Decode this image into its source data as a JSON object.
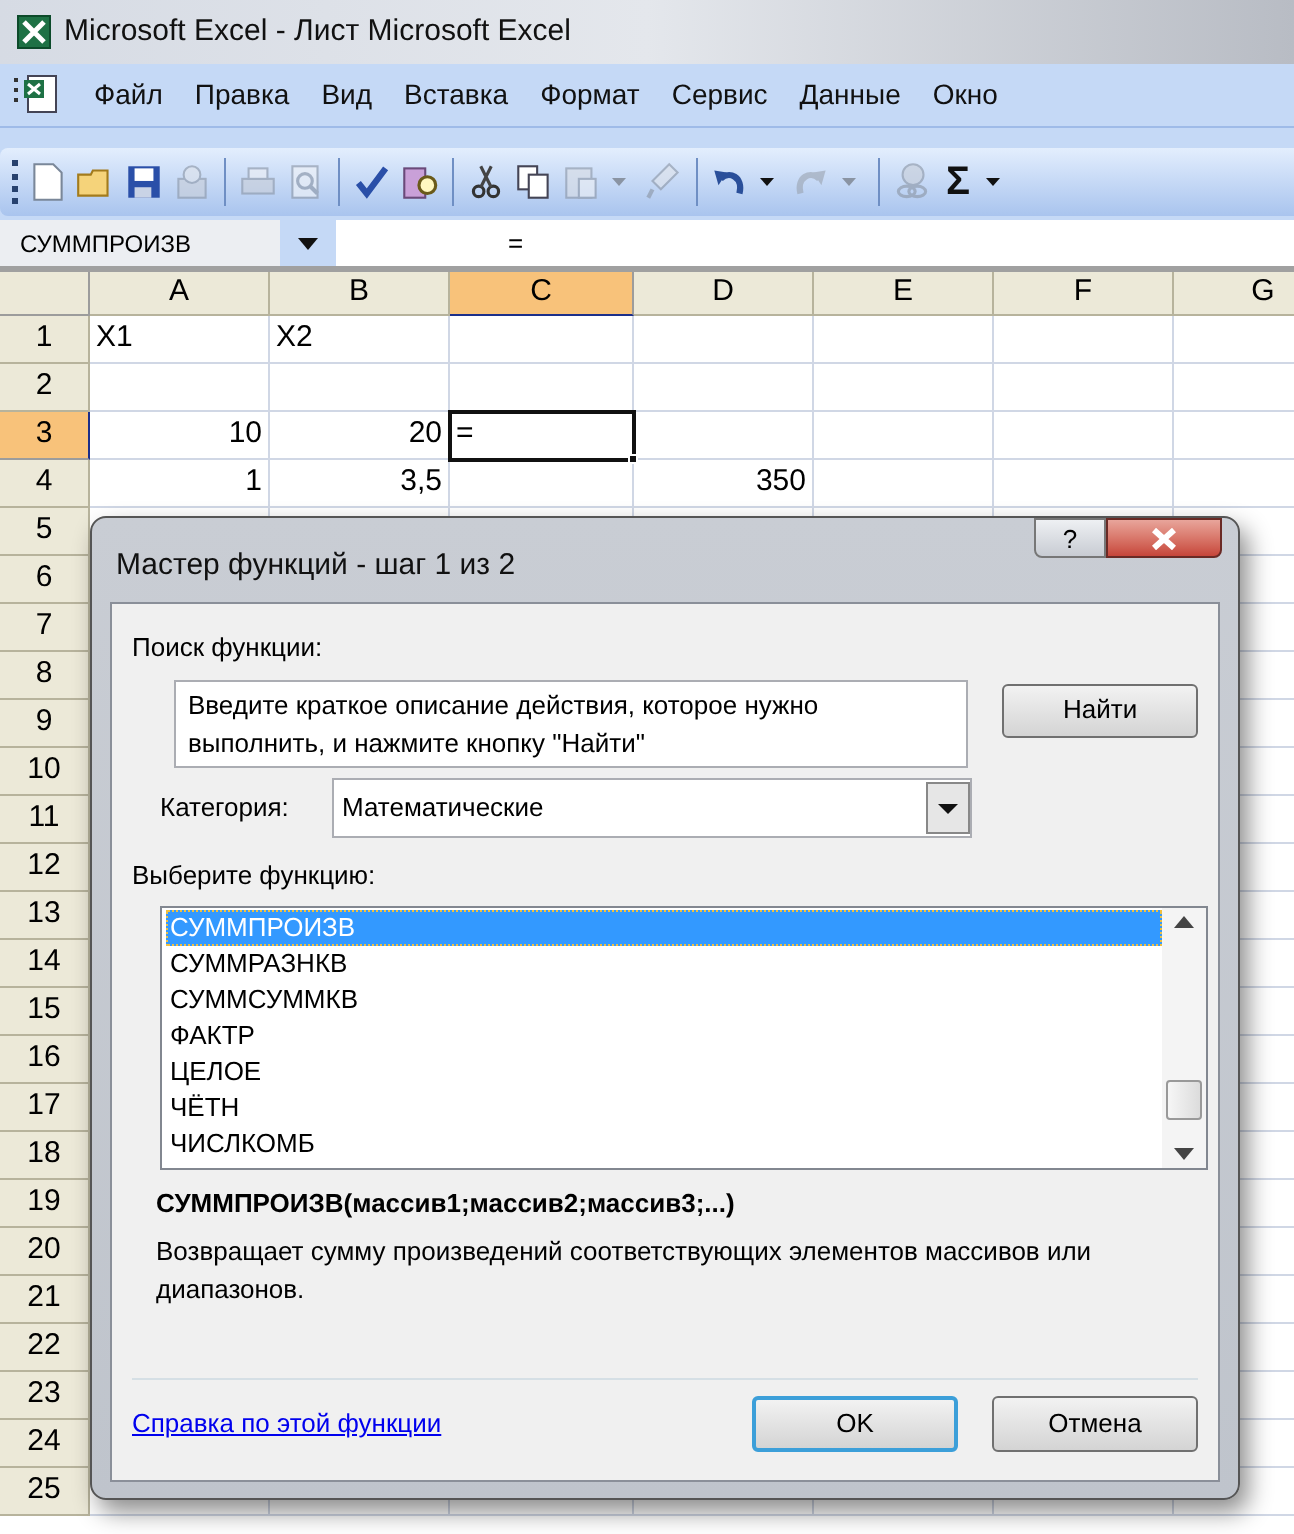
{
  "window": {
    "title": "Microsoft Excel - Лист Microsoft Excel"
  },
  "menu": [
    "Файл",
    "Правка",
    "Вид",
    "Вставка",
    "Формат",
    "Сервис",
    "Данные",
    "Окно"
  ],
  "toolbar": [
    [
      {
        "kind": "new",
        "disabled": false
      },
      {
        "kind": "open",
        "disabled": false
      },
      {
        "kind": "save",
        "disabled": false
      },
      {
        "kind": "permission",
        "disabled": true
      }
    ],
    [
      {
        "kind": "print",
        "disabled": true
      },
      {
        "kind": "preview",
        "disabled": true
      }
    ],
    [
      {
        "kind": "spelling",
        "disabled": false
      },
      {
        "kind": "research",
        "disabled": false
      }
    ],
    [
      {
        "kind": "cut",
        "disabled": false
      },
      {
        "kind": "copy",
        "disabled": false
      },
      {
        "kind": "paste",
        "disabled": true,
        "dropdown": true
      },
      {
        "kind": "painter",
        "disabled": true
      }
    ],
    [
      {
        "kind": "undo",
        "disabled": false,
        "dropdown": true
      },
      {
        "kind": "redo",
        "disabled": true,
        "dropdown": true
      }
    ],
    [
      {
        "kind": "hyperlink",
        "disabled": true
      },
      {
        "kind": "sum",
        "disabled": false,
        "dropdown": true,
        "glyph": "Σ"
      }
    ]
  ],
  "name_box": "СУММПРОИЗВ",
  "formula": "=",
  "columns": [
    {
      "label": "A",
      "selected": false
    },
    {
      "label": "B",
      "selected": false
    },
    {
      "label": "C",
      "selected": true
    },
    {
      "label": "D",
      "selected": false
    },
    {
      "label": "E",
      "selected": false
    },
    {
      "label": "F",
      "selected": false
    },
    {
      "label": "G",
      "selected": false
    }
  ],
  "rows": [
    {
      "label": "1",
      "selected": false,
      "cells": [
        {
          "text": "X1",
          "kind": "text",
          "selected": false
        },
        {
          "text": "X2",
          "kind": "text",
          "selected": false
        },
        {
          "selected": false
        },
        {
          "selected": false
        },
        {
          "selected": false
        },
        {
          "selected": false
        },
        {
          "selected": false
        }
      ]
    },
    {
      "label": "2",
      "selected": false,
      "cells": [
        {
          "selected": false
        },
        {
          "selected": false
        },
        {
          "selected": false
        },
        {
          "selected": false
        },
        {
          "selected": false
        },
        {
          "selected": false
        },
        {
          "selected": false
        }
      ]
    },
    {
      "label": "3",
      "selected": true,
      "cells": [
        {
          "text": "10",
          "kind": "number",
          "selected": false
        },
        {
          "text": "20",
          "kind": "number",
          "selected": false
        },
        {
          "text": "=",
          "kind": "text",
          "selected": true
        },
        {
          "selected": false
        },
        {
          "selected": false
        },
        {
          "selected": false
        },
        {
          "selected": false
        }
      ]
    },
    {
      "label": "4",
      "selected": false,
      "cells": [
        {
          "text": "1",
          "kind": "number",
          "selected": false
        },
        {
          "text": "3,5",
          "kind": "number",
          "selected": false
        },
        {
          "selected": false
        },
        {
          "text": "350",
          "kind": "number",
          "selected": false
        },
        {
          "selected": false
        },
        {
          "selected": false
        },
        {
          "selected": false
        }
      ]
    },
    {
      "label": "5",
      "selected": false
    },
    {
      "label": "6",
      "selected": false
    },
    {
      "label": "7",
      "selected": false
    },
    {
      "label": "8",
      "selected": false
    },
    {
      "label": "9",
      "selected": false
    },
    {
      "label": "10",
      "selected": false
    },
    {
      "label": "11",
      "selected": false
    },
    {
      "label": "12",
      "selected": false
    },
    {
      "label": "13",
      "selected": false
    },
    {
      "label": "14",
      "selected": false
    },
    {
      "label": "15",
      "selected": false
    },
    {
      "label": "16",
      "selected": false
    },
    {
      "label": "17",
      "selected": false
    },
    {
      "label": "18",
      "selected": false
    },
    {
      "label": "19",
      "selected": false
    },
    {
      "label": "20",
      "selected": false
    },
    {
      "label": "21",
      "selected": false
    },
    {
      "label": "22",
      "selected": false
    },
    {
      "label": "23",
      "selected": false
    },
    {
      "label": "24",
      "selected": false
    },
    {
      "label": "25",
      "selected": false
    }
  ],
  "dialog": {
    "title": "Мастер функций - шаг 1 из 2",
    "help_glyph": "?",
    "search_label": "Поиск функции:",
    "search_value": "Введите краткое описание действия, которое нужно выполнить, и нажмите кнопку \"Найти\"",
    "find_button": "Найти",
    "category_label": "Категория:",
    "category_value": "Математические",
    "list_label": "Выберите функцию:",
    "functions": [
      {
        "label": "СУММПРОИЗВ",
        "selected": true
      },
      {
        "label": "СУММРАЗНКВ",
        "selected": false
      },
      {
        "label": "СУММСУММКВ",
        "selected": false
      },
      {
        "label": "ФАКТР",
        "selected": false
      },
      {
        "label": "ЦЕЛОЕ",
        "selected": false
      },
      {
        "label": "ЧЁТН",
        "selected": false
      },
      {
        "label": "ЧИСЛКОМБ",
        "selected": false
      }
    ],
    "signature": "СУММПРОИЗВ(массив1;массив2;массив3;...)",
    "description": "Возвращает сумму произведений соответствующих элементов массивов или диапазонов.",
    "help_link": "Справка по этой функции",
    "buttons": [
      {
        "label": "OK",
        "default": true
      },
      {
        "label": "Отмена",
        "default": false
      }
    ]
  }
}
